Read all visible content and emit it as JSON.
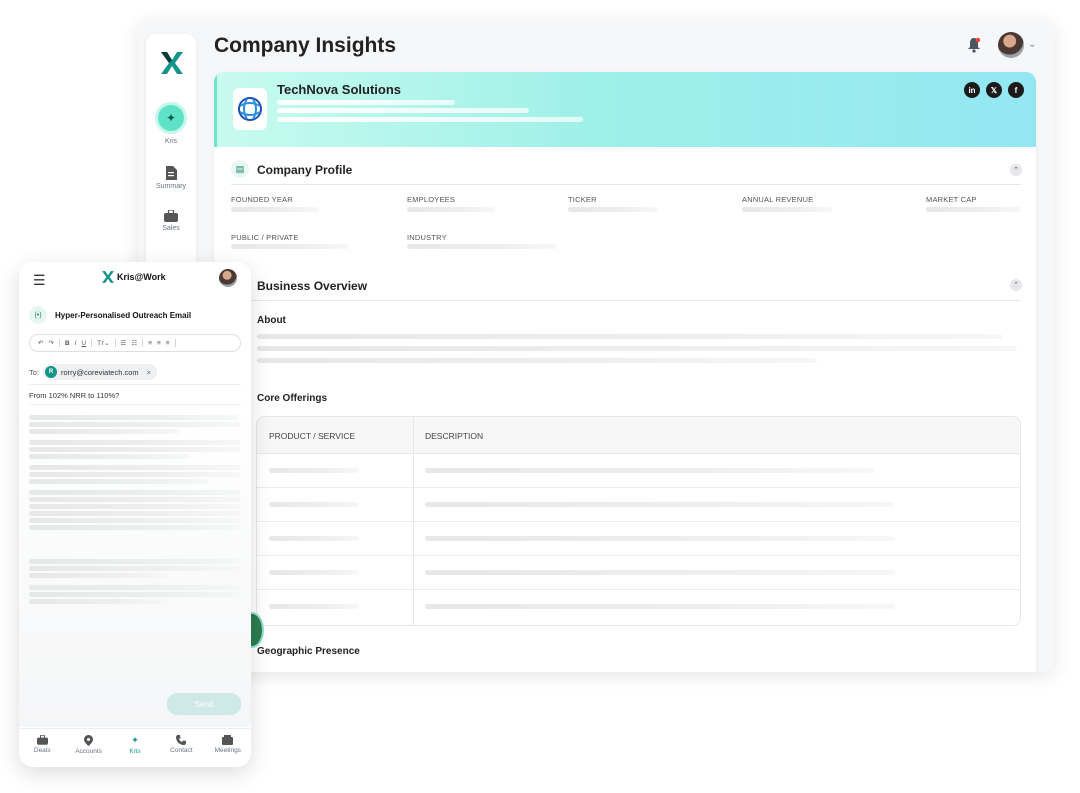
{
  "desktop": {
    "page_title": "Company Insights",
    "sidebar": {
      "items": [
        {
          "label": "Kris",
          "icon": "sparkles-icon"
        },
        {
          "label": "Summary",
          "icon": "document-icon"
        },
        {
          "label": "Sales",
          "icon": "briefcase-icon"
        }
      ]
    },
    "company": {
      "name": "TechNova Solutions",
      "socials": [
        "in",
        "𝕏",
        "f"
      ]
    },
    "profile": {
      "title": "Company Profile",
      "fields": [
        "FOUNDED YEAR",
        "EMPLOYEES",
        "TICKER",
        "ANNUAL REVENUE",
        "MARKET CAP",
        "PUBLIC / PRIVATE",
        "INDUSTRY"
      ]
    },
    "business": {
      "title": "Business Overview",
      "about": "About",
      "core_offerings": "Core Offerings",
      "geo": "Geographic Presence",
      "table_headers": [
        "PRODUCT / SERVICE",
        "DESCRIPTION"
      ]
    }
  },
  "mobile": {
    "brand": "Kris@Work",
    "composer_title": "Hyper-Personalised Outreach Email",
    "toolbar": {
      "undo": "↶",
      "redo": "↷",
      "bold": "B",
      "italic": "I",
      "underline": "U",
      "text_size": "Tт⌄",
      "list_bullet": "☰",
      "list_num": "☷",
      "align_left": "≡",
      "align_center": "≡",
      "align_right": "≡"
    },
    "to_label": "To:",
    "recipient_initial": "R",
    "recipient": "rorry@coreviatech.com",
    "subject": "From 102% NRR to 110%?",
    "send_label": "Send",
    "nav": [
      {
        "label": "Deals"
      },
      {
        "label": "Accounts"
      },
      {
        "label": "Kris"
      },
      {
        "label": "Contact"
      },
      {
        "label": "Meetings"
      }
    ]
  },
  "colors": {
    "accent": "#15958a",
    "hero_start": "#c8fbef",
    "hero_end": "#93e7f2"
  }
}
